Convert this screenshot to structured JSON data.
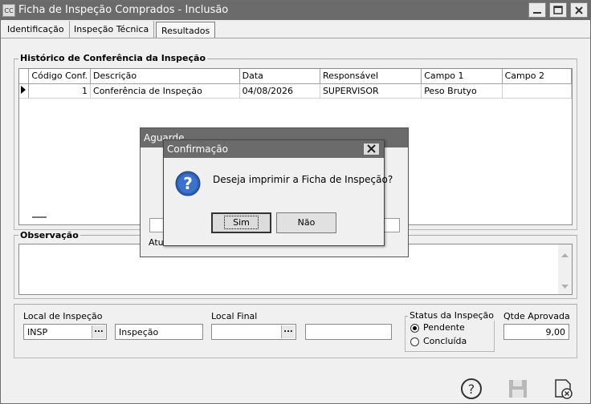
{
  "window": {
    "app_icon": "CC",
    "title": "Ficha de Inspeção Comprados - Inclusão"
  },
  "tabs": [
    {
      "label": "Identificação"
    },
    {
      "label": "Inspeção Técnica"
    },
    {
      "label": "Resultados",
      "active": true
    }
  ],
  "historico": {
    "title": "Histórico de Conferência da Inspeção",
    "columns": [
      "Código Conf.",
      "Descrição",
      "Data",
      "Responsável",
      "Campo 1",
      "Campo 2"
    ],
    "rows": [
      {
        "codigo": "1",
        "descricao": "Conferência de Inspeção",
        "data": "04/08/2026",
        "responsavel": "SUPERVISOR",
        "campo1": "Peso Brutyo",
        "campo2": ""
      }
    ]
  },
  "observacao": {
    "title": "Observação",
    "value": ""
  },
  "local_inspecao": {
    "label": "Local de Inspeção",
    "code": "INSP",
    "name": "Inspeção",
    "lookup_glyph": "..."
  },
  "local_final": {
    "label": "Local Final",
    "code": "",
    "name": "",
    "lookup_glyph": "..."
  },
  "status": {
    "label": "Status da Inspeção",
    "options": [
      {
        "label": "Pendente",
        "selected": true
      },
      {
        "label": "Concluída",
        "selected": false
      }
    ]
  },
  "qtde_aprovada": {
    "label": "Qtde Aprovada",
    "value": "9,00"
  },
  "aguarde": {
    "title": "Aguarde",
    "status_text": "Atua"
  },
  "confirm": {
    "title": "Confirmação",
    "message": "Deseja imprimir a Ficha de Inspeção?",
    "yes_label": "Sim",
    "no_label": "Não"
  },
  "toolbar_icons": [
    "help-icon",
    "save-icon",
    "close-icon"
  ]
}
